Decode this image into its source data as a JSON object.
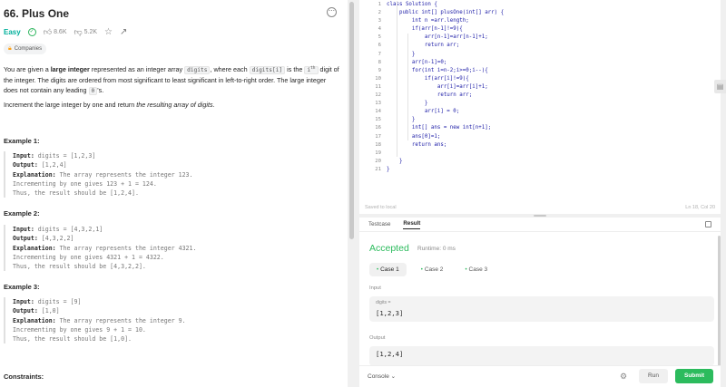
{
  "problem": {
    "title": "66. Plus One",
    "difficulty": "Easy",
    "likes": "8.6K",
    "dislikes": "5.2K",
    "companies_label": "Companies",
    "desc_p1_a": "You are given a ",
    "desc_p1_b": "large integer",
    "desc_p1_c": " represented as an integer array ",
    "desc_code_digits": "digits",
    "desc_p1_d": ", where each ",
    "desc_code_digitsi": "digits[i]",
    "desc_p1_e": " is the ",
    "desc_p1_ith": "i",
    "desc_p1_th": "th",
    "desc_p1_f": " digit of the integer. The digits are ordered from most significant to least significant in left-to-right order. The large integer does not contain any leading ",
    "desc_code_zero": "0",
    "desc_p1_g": "'s.",
    "desc_p2_a": "Increment the large integer by one and return ",
    "desc_p2_b": "the resulting array of digits",
    "desc_p2_c": ".",
    "examples": [
      {
        "title": "Example 1:",
        "input_label": "Input:",
        "input": " digits = [1,2,3]",
        "output_label": "Output:",
        "output": " [1,2,4]",
        "expl_label": "Explanation:",
        "expl": " The array represents the integer 123.",
        "line2": "Incrementing by one gives 123 + 1 = 124.",
        "line3": "Thus, the result should be [1,2,4]."
      },
      {
        "title": "Example 2:",
        "input_label": "Input:",
        "input": " digits = [4,3,2,1]",
        "output_label": "Output:",
        "output": " [4,3,2,2]",
        "expl_label": "Explanation:",
        "expl": " The array represents the integer 4321.",
        "line2": "Incrementing by one gives 4321 + 1 = 4322.",
        "line3": "Thus, the result should be [4,3,2,2]."
      },
      {
        "title": "Example 3:",
        "input_label": "Input:",
        "input": " digits = [9]",
        "output_label": "Output:",
        "output": " [1,0]",
        "expl_label": "Explanation:",
        "expl": " The array represents the integer 9.",
        "line2": "Incrementing by one gives 9 + 1 = 10.",
        "line3": "Thus, the result should be [1,0]."
      }
    ],
    "constraints_title": "Constraints:"
  },
  "editor": {
    "lines": [
      "class Solution {",
      "    public int[] plusOne(int[] arr) {",
      "        int n =arr.length;",
      "        if(arr[n-1]!=9){",
      "            arr[n-1]=arr[n-1]+1;",
      "            return arr;",
      "        }",
      "        arr[n-1]=0;",
      "        for(int i=n-2;i>=0;i--){",
      "            if(arr[i]!=9){",
      "                arr[i]=arr[i]+1;",
      "                return arr;",
      "            }",
      "            arr[i] = 0;",
      "        }",
      "        int[] ans = new int[n+1];",
      "        ans[0]=1;",
      "        return ans;",
      "",
      "    }",
      "}"
    ],
    "saved_label": "Saved to local",
    "cursor_position": "Ln 18, Col 20"
  },
  "result": {
    "tab_testcase": "Testcase",
    "tab_result": "Result",
    "status": "Accepted",
    "runtime": "Runtime: 0 ms",
    "cases": [
      "Case 1",
      "Case 2",
      "Case 3"
    ],
    "input_label": "Input",
    "input_var": "digits =",
    "input_value": "[1,2,3]",
    "output_label": "Output",
    "output_value": "[1,2,4]",
    "console_label": "Console",
    "run_label": "Run",
    "submit_label": "Submit"
  },
  "colors": {
    "accent_green": "#2cbb5d",
    "easy_teal": "#00af9b",
    "code_blue": "#1a1aa6"
  }
}
